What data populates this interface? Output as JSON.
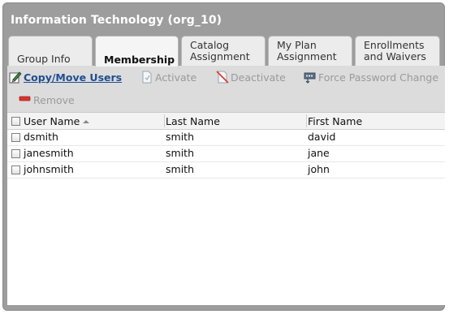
{
  "panel": {
    "title": "Information Technology (org_10)"
  },
  "tabs": [
    {
      "label": "Group Info",
      "line1": "Group Info",
      "line2": ""
    },
    {
      "label": "Membership",
      "line1": "Membership",
      "line2": ""
    },
    {
      "label": "Catalog Assignment",
      "line1": "Catalog",
      "line2": "Assignment"
    },
    {
      "label": "My Plan Assignment",
      "line1": "My Plan",
      "line2": "Assignment"
    },
    {
      "label": "Enrollments and Waivers",
      "line1": "Enrollments",
      "line2": "and Waivers"
    }
  ],
  "active_tab": "Membership",
  "toolbar": {
    "copy_move": "Copy/Move Users",
    "activate": "Activate",
    "deactivate": "Deactivate",
    "force_password": "Force Password Change",
    "remove": "Remove",
    "icons": {
      "copy_move": "edit-pencil-icon",
      "activate": "activate-document-icon",
      "deactivate": "deactivate-document-icon",
      "force_password": "password-reset-icon",
      "remove": "remove-minus-icon"
    }
  },
  "grid": {
    "columns": [
      "User Name",
      "Last Name",
      "First Name"
    ],
    "sorted_column": "User Name",
    "sort_direction": "ascending",
    "rows": [
      {
        "user_name": "dsmith",
        "last_name": "smith",
        "first_name": "david"
      },
      {
        "user_name": "janesmith",
        "last_name": "smith",
        "first_name": "jane"
      },
      {
        "user_name": "johnsmith",
        "last_name": "smith",
        "first_name": "john"
      }
    ]
  },
  "colors": {
    "panel_bg": "#9d9d9d",
    "toolbar_bg": "#dcdcdc",
    "link": "#1f4e91",
    "disabled": "#9a9a9a",
    "remove_red": "#d9342b"
  }
}
